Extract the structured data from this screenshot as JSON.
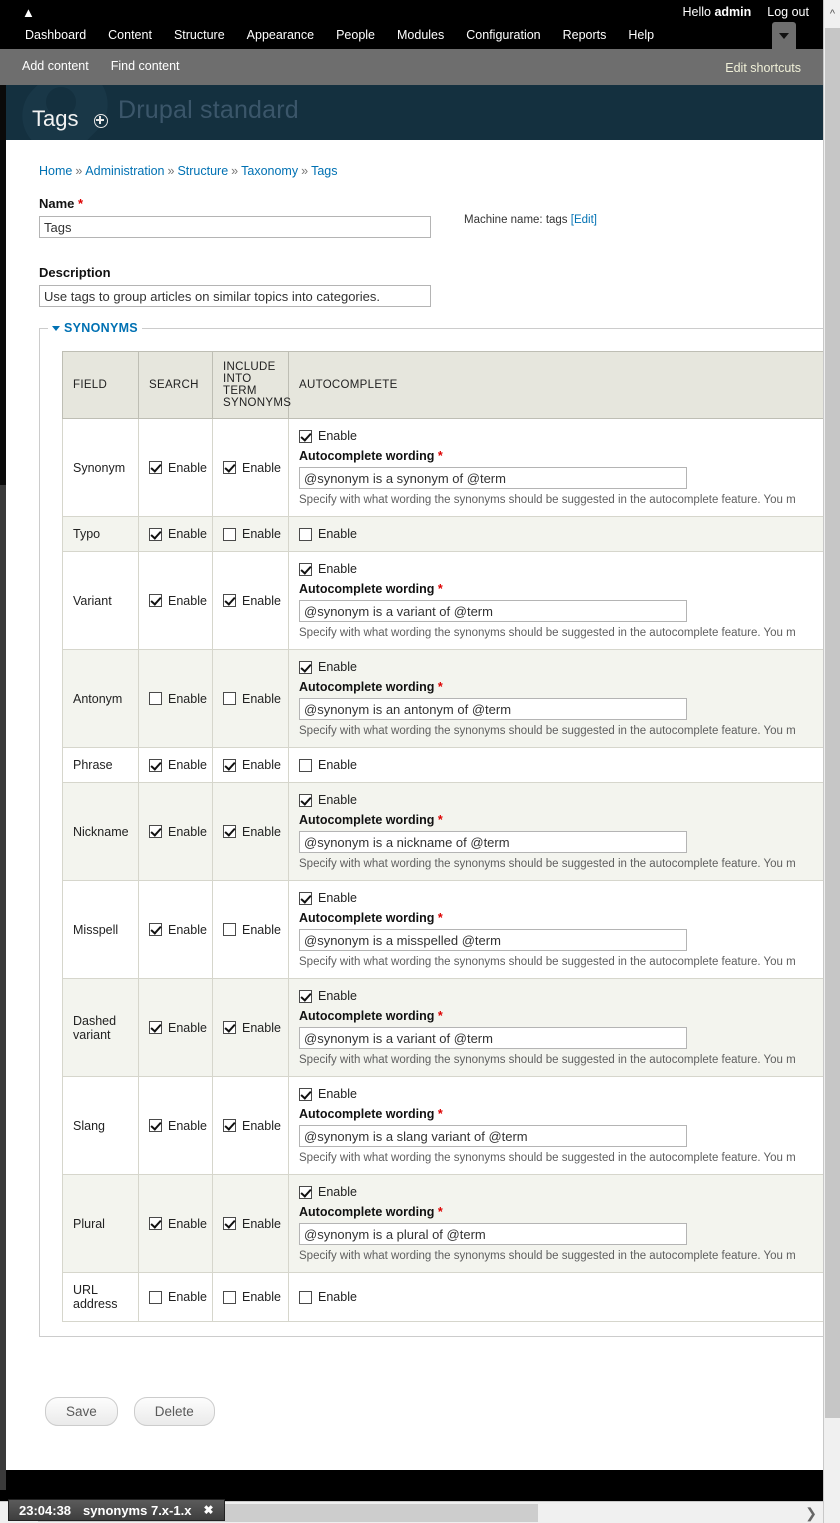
{
  "toolbar": {
    "home_icon": "home-icon",
    "greeting_prefix": "Hello",
    "username": "admin",
    "logout": "Log out",
    "menu": [
      "Dashboard",
      "Content",
      "Structure",
      "Appearance",
      "People",
      "Modules",
      "Configuration",
      "Reports",
      "Help"
    ],
    "dropdown_icon": "chevron-down-icon"
  },
  "shortcuts": {
    "items": [
      "Add content",
      "Find content"
    ],
    "edit": "Edit shortcuts"
  },
  "header": {
    "site_name": "Drupal standard",
    "page_title": "Tags",
    "title_icon": "configure-icon"
  },
  "breadcrumb": {
    "separator": "»",
    "items": [
      "Home",
      "Administration",
      "Structure",
      "Taxonomy",
      "Tags"
    ]
  },
  "form": {
    "name_label": "Name",
    "name_value": "Tags",
    "machine_name_text": "Machine name: tags",
    "machine_name_edit": "[Edit]",
    "description_label": "Description",
    "description_value": "Use tags to group articles on similar topics into categories.",
    "required_mark": "*"
  },
  "fieldset": {
    "legend": "SYNONYMS",
    "collapse_icon": "caret-down-icon"
  },
  "table": {
    "headers": [
      "FIELD",
      "SEARCH",
      "INCLUDE INTO TERM SYNONYMS",
      "AUTOCOMPLETE"
    ],
    "enable_label": "Enable",
    "autocomplete_wording_label": "Autocomplete wording",
    "autocomplete_description": "Specify with what wording the synonyms should be suggested in the autocomplete feature. You m",
    "rows": [
      {
        "field": "Synonym",
        "search": true,
        "include": true,
        "autocomplete": true,
        "wording": "@synonym is a synonym of @term"
      },
      {
        "field": "Typo",
        "search": true,
        "include": false,
        "autocomplete": false,
        "wording": ""
      },
      {
        "field": "Variant",
        "search": true,
        "include": true,
        "autocomplete": true,
        "wording": "@synonym is a variant of @term"
      },
      {
        "field": "Antonym",
        "search": false,
        "include": false,
        "autocomplete": true,
        "wording": "@synonym is an antonym of @term"
      },
      {
        "field": "Phrase",
        "search": true,
        "include": true,
        "autocomplete": false,
        "wording": ""
      },
      {
        "field": "Nickname",
        "search": true,
        "include": true,
        "autocomplete": true,
        "wording": "@synonym is a nickname of @term"
      },
      {
        "field": "Misspell",
        "search": true,
        "include": false,
        "autocomplete": true,
        "wording": "@synonym is a misspelled @term"
      },
      {
        "field": "Dashed variant",
        "search": true,
        "include": true,
        "autocomplete": true,
        "wording": "@synonym is a variant of @term"
      },
      {
        "field": "Slang",
        "search": true,
        "include": true,
        "autocomplete": true,
        "wording": "@synonym is a slang variant of @term"
      },
      {
        "field": "Plural",
        "search": true,
        "include": true,
        "autocomplete": true,
        "wording": "@synonym is a plural of @term"
      },
      {
        "field": "URL address",
        "search": false,
        "include": false,
        "autocomplete": false,
        "wording": ""
      }
    ]
  },
  "actions": {
    "save": "Save",
    "delete": "Delete"
  },
  "taskbar": {
    "time": "23:04:38",
    "window_title": "synonyms 7.x-1.x",
    "close_icon": "✖"
  },
  "scrollbars": {
    "vertical_up_icon": "chevron-up-icon",
    "horizontal_right_icon": "chevron-right-icon"
  },
  "colors": {
    "toolbar_bg": "#000000",
    "shortcut_bg": "#6e6e6e",
    "header_bg": "#14303f",
    "link": "#0071b3",
    "required": "#dd0000",
    "table_header_bg": "#e6e6dd",
    "row_alt_bg": "#f3f4ee"
  }
}
